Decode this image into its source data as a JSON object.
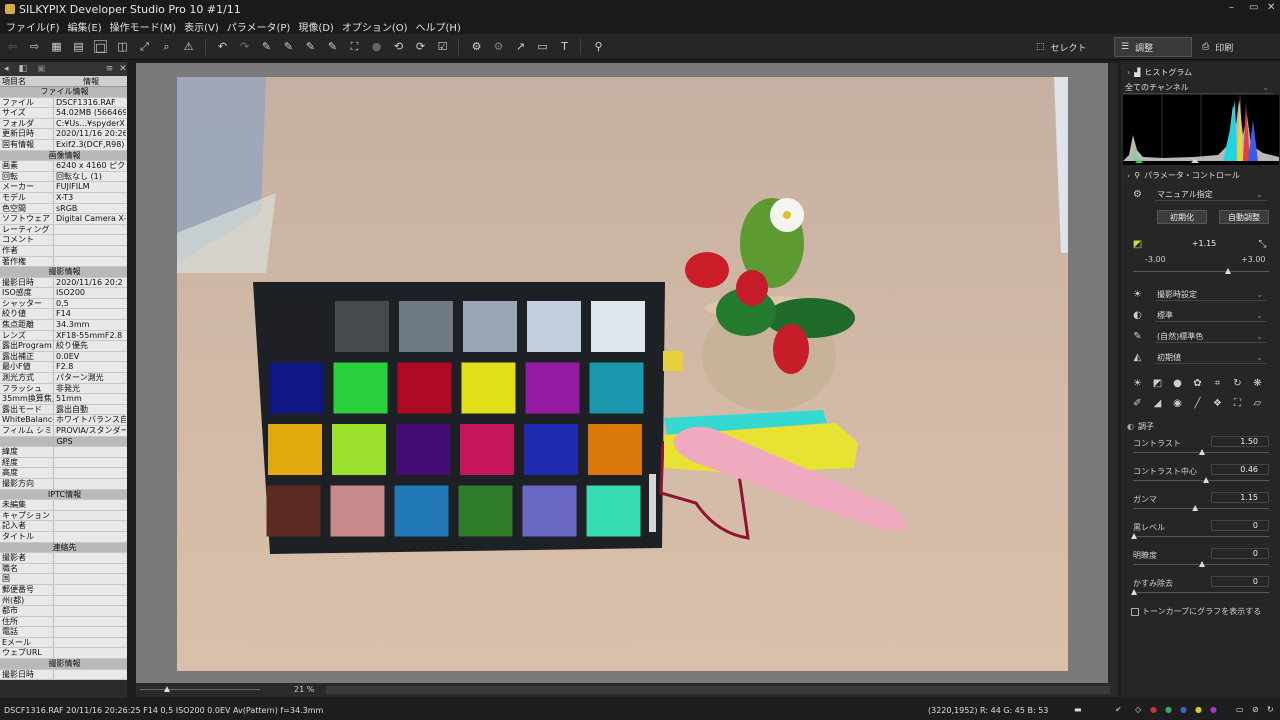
{
  "window": {
    "title": "SILKYPIX Developer Studio Pro 10   #1/11",
    "controls": [
      "–",
      "▭",
      "✕"
    ]
  },
  "menu": [
    "ファイル(F)",
    "編集(E)",
    "操作モード(M)",
    "表示(V)",
    "パラメータ(P)",
    "現像(D)",
    "オプション(O)",
    "ヘルプ(H)"
  ],
  "modes": {
    "select": "セレクト",
    "adjust": "調整",
    "print": "印刷"
  },
  "left_panel": {
    "col_item": "項目名",
    "col_info": "情報",
    "rows": [
      {
        "k": "ファイル情報",
        "sec": true
      },
      {
        "k": "ファイル",
        "v": "DSCF1316.RAF"
      },
      {
        "k": "サイズ",
        "v": "54.02MB (5664697"
      },
      {
        "k": "フォルダ",
        "v": "C:¥Us...¥spyderX"
      },
      {
        "k": "更新日時",
        "v": "2020/11/16 20:26"
      },
      {
        "k": "固有情報",
        "v": "Exif2.3(DCF,R98) Y"
      },
      {
        "k": "画像情報",
        "sec": true
      },
      {
        "k": "画素",
        "v": "6240 x 4160 ピクセ"
      },
      {
        "k": "回転",
        "v": "回転なし (1)"
      },
      {
        "k": "メーカー",
        "v": "FUJIFILM"
      },
      {
        "k": "モデル",
        "v": "X-T3"
      },
      {
        "k": "色空間",
        "v": "sRGB"
      },
      {
        "k": "ソフトウェア",
        "v": "Digital Camera X-T"
      },
      {
        "k": "レーティング",
        "v": ""
      },
      {
        "k": "コメント",
        "v": ""
      },
      {
        "k": "作者",
        "v": ""
      },
      {
        "k": "著作権",
        "v": ""
      },
      {
        "k": "撮影情報",
        "sec": true
      },
      {
        "k": "撮影日時",
        "v": "2020/11/16 20:2"
      },
      {
        "k": "ISO感度",
        "v": "ISO200"
      },
      {
        "k": "シャッター",
        "v": "0,5"
      },
      {
        "k": "絞り値",
        "v": "F14"
      },
      {
        "k": "焦点距離",
        "v": "34.3mm"
      },
      {
        "k": "レンズ",
        "v": "XF18-55mmF2.8"
      },
      {
        "k": "露出Program",
        "v": "絞り優先"
      },
      {
        "k": "露出補正",
        "v": "0.0EV"
      },
      {
        "k": "最小F値",
        "v": "F2.8"
      },
      {
        "k": "測光方式",
        "v": "パターン測光"
      },
      {
        "k": "フラッシュ",
        "v": "非発光"
      },
      {
        "k": "35mm換算焦点",
        "v": "51mm"
      },
      {
        "k": "露出モード",
        "v": "露出自動"
      },
      {
        "k": "WhiteBalance",
        "v": "ホワイトバランス自動"
      },
      {
        "k": "フィルム シミュレ",
        "v": "PROVIA/スタンダード"
      },
      {
        "k": "GPS",
        "sec": true
      },
      {
        "k": "緯度",
        "v": ""
      },
      {
        "k": "経度",
        "v": ""
      },
      {
        "k": "高度",
        "v": ""
      },
      {
        "k": "撮影方向",
        "v": ""
      },
      {
        "k": "IPTC情報",
        "sec": true
      },
      {
        "k": "未編集",
        "v": ""
      },
      {
        "k": "キャプション",
        "v": ""
      },
      {
        "k": "記入者",
        "v": ""
      },
      {
        "k": "タイトル",
        "v": ""
      },
      {
        "k": "連絡先",
        "sec": true
      },
      {
        "k": "撮影者",
        "v": ""
      },
      {
        "k": "職名",
        "v": ""
      },
      {
        "k": "国",
        "v": ""
      },
      {
        "k": "郵便番号",
        "v": ""
      },
      {
        "k": "州(都)",
        "v": ""
      },
      {
        "k": "都市",
        "v": ""
      },
      {
        "k": "住所",
        "v": ""
      },
      {
        "k": "電話",
        "v": ""
      },
      {
        "k": "Eメール",
        "v": ""
      },
      {
        "k": "ウェブURL",
        "v": ""
      },
      {
        "k": "撮影情報",
        "sec": true
      },
      {
        "k": "撮影日時",
        "v": ""
      }
    ]
  },
  "right_panel": {
    "histogram_title": "ヒストグラム",
    "histogram_channel": "全てのチャンネル",
    "param_title": "パラメータ・コントロール",
    "preset": "マニュアル指定",
    "init_button": "初期化",
    "auto_button": "自動調整",
    "exposure_value": "+1.15",
    "exposure_min": "-3.00",
    "exposure_max": "+3.00",
    "dropdowns": [
      "撮影時設定",
      "標準",
      "(自然)標準色",
      "初期値"
    ],
    "tone_title": "調子",
    "sliders": [
      {
        "label": "コントラスト",
        "value": "1.50",
        "knob": 0.5
      },
      {
        "label": "コントラスト中心",
        "value": "0.46",
        "knob": 0.53
      },
      {
        "label": "ガンマ",
        "value": "1.15",
        "knob": 0.45
      },
      {
        "label": "黒レベル",
        "value": "0",
        "knob": 0.0
      },
      {
        "label": "明瞭度",
        "value": "0",
        "knob": 0.5
      },
      {
        "label": "かすみ除去",
        "value": "0",
        "knob": 0.0
      }
    ],
    "tone_curve_checkbox": "トーンカーブにグラフを表示する"
  },
  "bottom": {
    "zoom": "21 %"
  },
  "status": {
    "left": "DSCF1316.RAF 20/11/16 20:26:25 F14 0,5 ISO200  0.0EV Av(Pattern) f=34.3mm",
    "pixel": "(3220,1952) R: 44 G: 45 B: 53"
  },
  "colors": {
    "checker": [
      [
        "#1f2023",
        "#454a4f",
        "#6f7a85",
        "#9aa6b3",
        "#c3cfdc",
        "#dfe6ee"
      ],
      [
        "#101784",
        "#2ad03c",
        "#ae0a25",
        "#e1df19",
        "#951aa2",
        "#1a96ad"
      ],
      [
        "#e2a90f",
        "#9ce12b",
        "#460c76",
        "#c7155c",
        "#202aae",
        "#d97709"
      ],
      [
        "#5e2b23",
        "#c98a8b",
        "#2279b8",
        "#2e7b29",
        "#6b68c3",
        "#35ddb1"
      ]
    ]
  }
}
